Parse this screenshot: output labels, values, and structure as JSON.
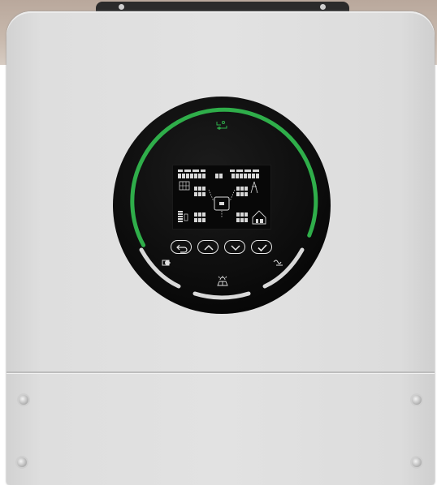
{
  "device": {
    "type": "hybrid solar inverter",
    "body_color": "#e0e0e0",
    "bezel_color": "#000000",
    "ring_status_color": "#2fae4a",
    "ring_idle_color": "#d9d9d9"
  },
  "lcd": {
    "digits_placeholder": "888",
    "segment_color": "#d8d8d8"
  },
  "buttons": [
    {
      "name": "back-button",
      "icon": "return-arrow-icon"
    },
    {
      "name": "up-button",
      "icon": "chevron-up-icon"
    },
    {
      "name": "down-button",
      "icon": "chevron-down-icon"
    },
    {
      "name": "confirm-button",
      "icon": "checkmark-icon"
    }
  ],
  "indicators": [
    {
      "name": "battery-indicator",
      "icon": "battery-icon"
    },
    {
      "name": "ac-output-indicator",
      "icon": "ac-wave-icon"
    },
    {
      "name": "solar-indicator",
      "icon": "solar-panel-icon"
    },
    {
      "name": "comm-indicator",
      "icon": "link-icon"
    }
  ]
}
